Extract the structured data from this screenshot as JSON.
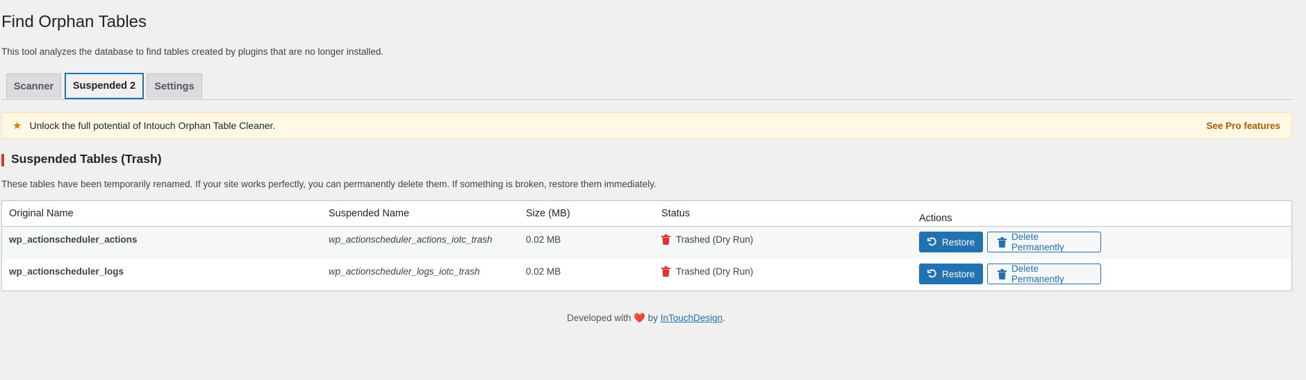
{
  "page": {
    "title": "Find Orphan Tables",
    "description": "This tool analyzes the database to find tables created by plugins that are no longer installed."
  },
  "tabs": [
    {
      "label": "Scanner"
    },
    {
      "label": "Suspended 2"
    },
    {
      "label": "Settings"
    }
  ],
  "promo": {
    "text": "Unlock the full potential of Intouch Orphan Table Cleaner.",
    "link": "See Pro features",
    "icon": "star-icon"
  },
  "section": {
    "title": "Suspended Tables (Trash)",
    "description": "These tables have been temporarily renamed. If your site works perfectly, you can permanently delete them. If something is broken, restore them immediately."
  },
  "table": {
    "headers": [
      "Original Name",
      "Suspended Name",
      "Size (MB)",
      "Status",
      "Actions"
    ],
    "rows": [
      {
        "original": "wp_actionscheduler_actions",
        "suspended": "wp_actionscheduler_actions_iotc_trash",
        "size": "0.02 MB",
        "status": "Trashed (Dry Run)",
        "restore_label": "Restore",
        "delete_label": "Delete Permanently"
      },
      {
        "original": "wp_actionscheduler_logs",
        "suspended": "wp_actionscheduler_logs_iotc_trash",
        "size": "0.02 MB",
        "status": "Trashed (Dry Run)",
        "restore_label": "Restore",
        "delete_label": "Delete Permanently"
      }
    ]
  },
  "footer": {
    "prefix": "Developed with",
    "heart": "❤️",
    "by": "by",
    "link": "InTouchDesign",
    "suffix": "."
  },
  "colors": {
    "accent": "#2271b1",
    "danger": "#d63638",
    "promo_bg": "#fff8e5",
    "promo_link": "#b35900"
  }
}
